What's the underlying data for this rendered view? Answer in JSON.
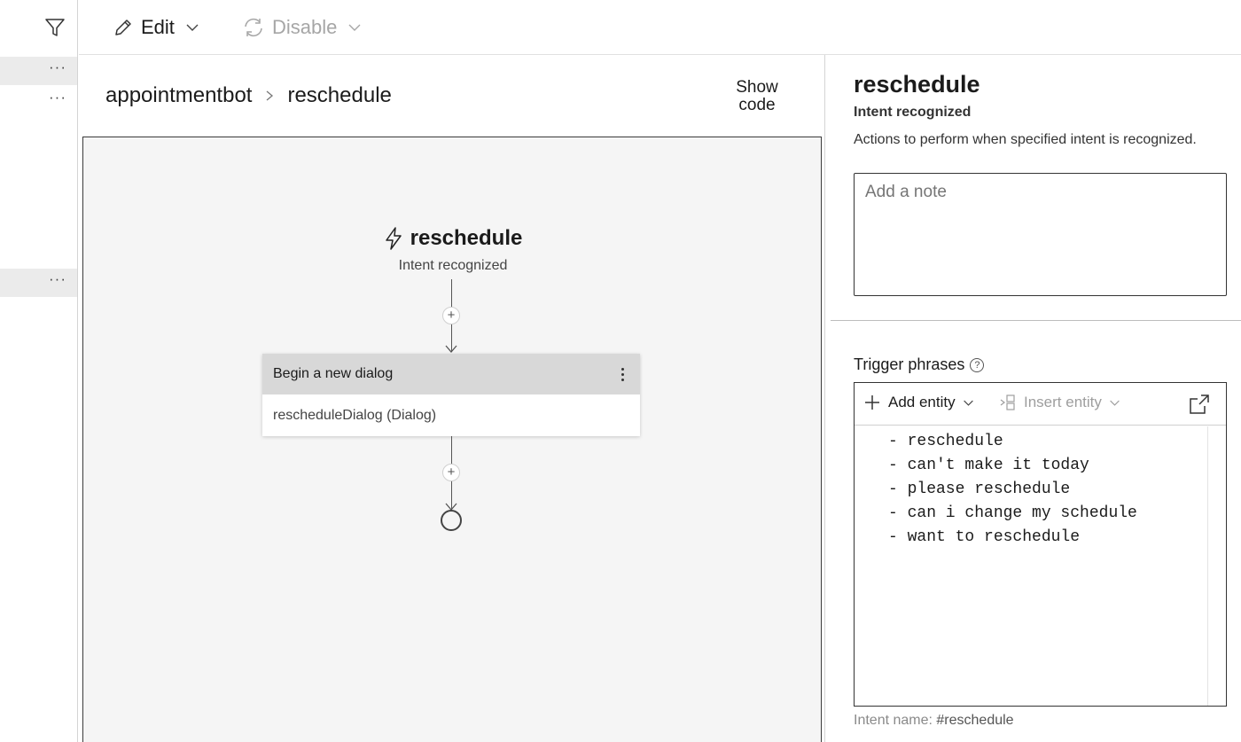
{
  "toolbar": {
    "edit_label": "Edit",
    "disable_label": "Disable"
  },
  "leftnav": {
    "filter_icon": "filter-icon",
    "more_label": "···"
  },
  "breadcrumb": {
    "root": "appointmentbot",
    "current": "reschedule"
  },
  "show_code": {
    "line1": "Show",
    "line2": "code"
  },
  "flow": {
    "trigger_title": "reschedule",
    "trigger_subtitle": "Intent recognized",
    "action_title": "Begin a new dialog",
    "action_body": "rescheduleDialog (Dialog)",
    "plus": "+"
  },
  "props": {
    "title": "reschedule",
    "type": "Intent recognized",
    "description": "Actions to perform when specified intent is recognized.",
    "note_placeholder": "Add a note",
    "trigger_phrases_label": "Trigger phrases",
    "help": "?",
    "add_entity_label": "Add entity",
    "insert_entity_label": "Insert entity",
    "phrases": [
      "- reschedule",
      "- can't make it today",
      "- please reschedule",
      "- can i change my schedule",
      "- want to reschedule"
    ],
    "intent_name_label": "Intent name:",
    "intent_name_value": "#reschedule"
  }
}
